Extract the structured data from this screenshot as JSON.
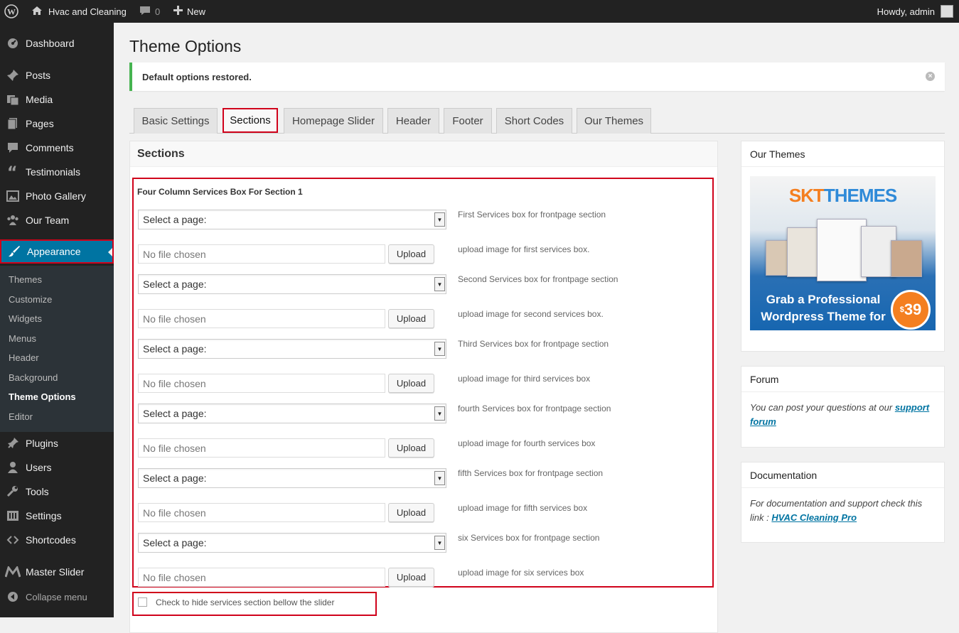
{
  "adminbar": {
    "site_name": "Hvac and Cleaning",
    "comment_count": "0",
    "new_label": "New",
    "howdy": "Howdy, admin"
  },
  "sidebar": {
    "items": [
      {
        "label": "Dashboard",
        "icon": "dashboard-icon"
      },
      {
        "label": "Posts",
        "icon": "pin-icon"
      },
      {
        "label": "Media",
        "icon": "media-icon"
      },
      {
        "label": "Pages",
        "icon": "pages-icon"
      },
      {
        "label": "Comments",
        "icon": "comment-icon"
      },
      {
        "label": "Testimonials",
        "icon": "quote-icon"
      },
      {
        "label": "Photo Gallery",
        "icon": "image-icon"
      },
      {
        "label": "Our Team",
        "icon": "team-icon"
      },
      {
        "label": "Appearance",
        "icon": "brush-icon"
      }
    ],
    "appearance_submenu": [
      "Themes",
      "Customize",
      "Widgets",
      "Menus",
      "Header",
      "Background",
      "Theme Options",
      "Editor"
    ],
    "lower_items": [
      {
        "label": "Plugins",
        "icon": "plug-icon"
      },
      {
        "label": "Users",
        "icon": "user-icon"
      },
      {
        "label": "Tools",
        "icon": "wrench-icon"
      },
      {
        "label": "Settings",
        "icon": "settings-icon"
      },
      {
        "label": "Shortcodes",
        "icon": "code-icon"
      },
      {
        "label": "Master Slider",
        "icon": "slider-icon"
      }
    ],
    "collapse_label": "Collapse menu"
  },
  "page": {
    "title": "Theme Options",
    "notice": "Default options restored."
  },
  "tabs": [
    "Basic Settings",
    "Sections",
    "Homepage Slider",
    "Header",
    "Footer",
    "Short Codes",
    "Our Themes"
  ],
  "panel": {
    "title": "Sections",
    "section_title": "Four Column Services Box For Section 1",
    "select_placeholder": "Select a page:",
    "file_placeholder": "No file chosen",
    "upload_label": "Upload",
    "rows": [
      {
        "select_desc": "First Services box for frontpage section",
        "upload_desc": "upload image for first services box."
      },
      {
        "select_desc": "Second Services box for frontpage section",
        "upload_desc": "upload image for second services box."
      },
      {
        "select_desc": "Third Services box for frontpage section",
        "upload_desc": "upload image for third services box"
      },
      {
        "select_desc": "fourth Services box for frontpage section",
        "upload_desc": "upload image for fourth services box"
      },
      {
        "select_desc": "fifth Services box for frontpage section",
        "upload_desc": "upload image for fifth services box"
      },
      {
        "select_desc": "six Services box for frontpage section",
        "upload_desc": "upload image for six services box"
      }
    ],
    "checkbox_label": "Check to hide services section bellow the slider"
  },
  "widgets": {
    "our_themes": {
      "title": "Our Themes",
      "banner_brand_a": "SKT",
      "banner_brand_b": "THEMES",
      "banner_cta": "Grab a Professional Wordpress Theme for",
      "banner_price_symbol": "$",
      "banner_price": "39"
    },
    "forum": {
      "title": "Forum",
      "text": "You can post your questions at our",
      "link": "support forum"
    },
    "documentation": {
      "title": "Documentation",
      "text": "For documentation and support check this link :",
      "link": "HVAC Cleaning Pro"
    }
  },
  "colors": {
    "admin_bg": "#222222",
    "active_menu": "#0074a2",
    "highlight_red": "#d0021b",
    "notice_green": "#46b450"
  }
}
